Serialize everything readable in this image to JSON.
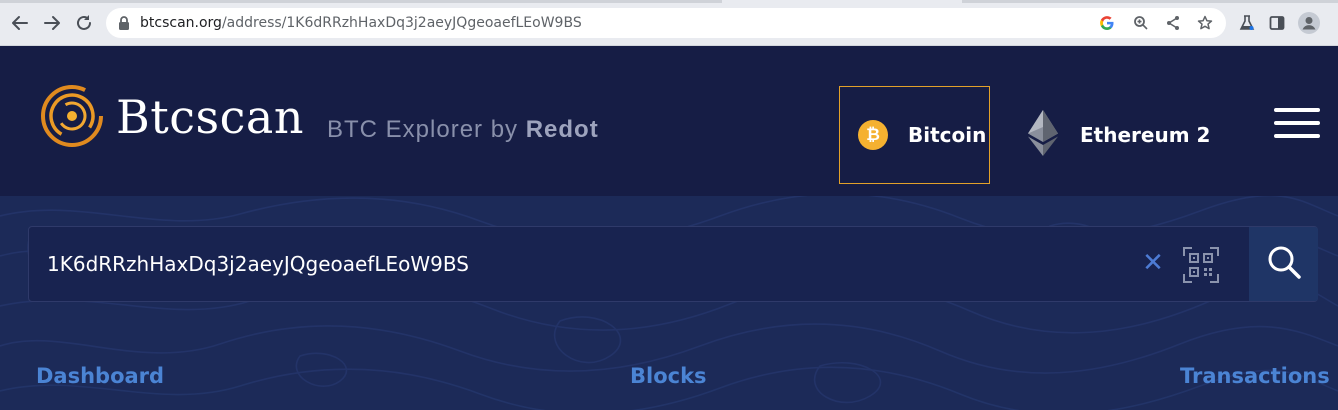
{
  "browser": {
    "url_host": "btcscan.org",
    "url_path": "/address/1K6dRRzhHaxDq3j2aeyJQgeoaefLEoW9BS",
    "icons": [
      "back-icon",
      "forward-icon",
      "reload-icon",
      "lock-icon",
      "google-icon",
      "zoom-icon",
      "share-icon",
      "bookmark-star-icon",
      "labs-icon",
      "side-panel-icon",
      "profile-icon"
    ]
  },
  "header": {
    "logo_text": "Btcscan",
    "tagline_prefix": "BTC Explorer by ",
    "tagline_brand": "Redot",
    "chains": [
      {
        "label": "Bitcoin",
        "icon": "bitcoin-icon",
        "selected": true
      },
      {
        "label": "Ethereum 2",
        "icon": "ethereum-icon",
        "selected": false
      }
    ],
    "menu_icon": "hamburger-menu-icon"
  },
  "search": {
    "value": "1K6dRRzhHaxDq3j2aeyJQgeoaefLEoW9BS",
    "clear_icon": "close-icon",
    "qr_icon": "qr-scan-icon",
    "search_icon": "search-icon"
  },
  "nav": {
    "dashboard": "Dashboard",
    "blocks": "Blocks",
    "transactions": "Transactions"
  },
  "colors": {
    "header_bg": "#161d45",
    "hero_bg": "#1c2a58",
    "accent_gold": "#e2a12a",
    "bitcoin_orange": "#f5b130",
    "link_blue": "#4b84d4"
  }
}
